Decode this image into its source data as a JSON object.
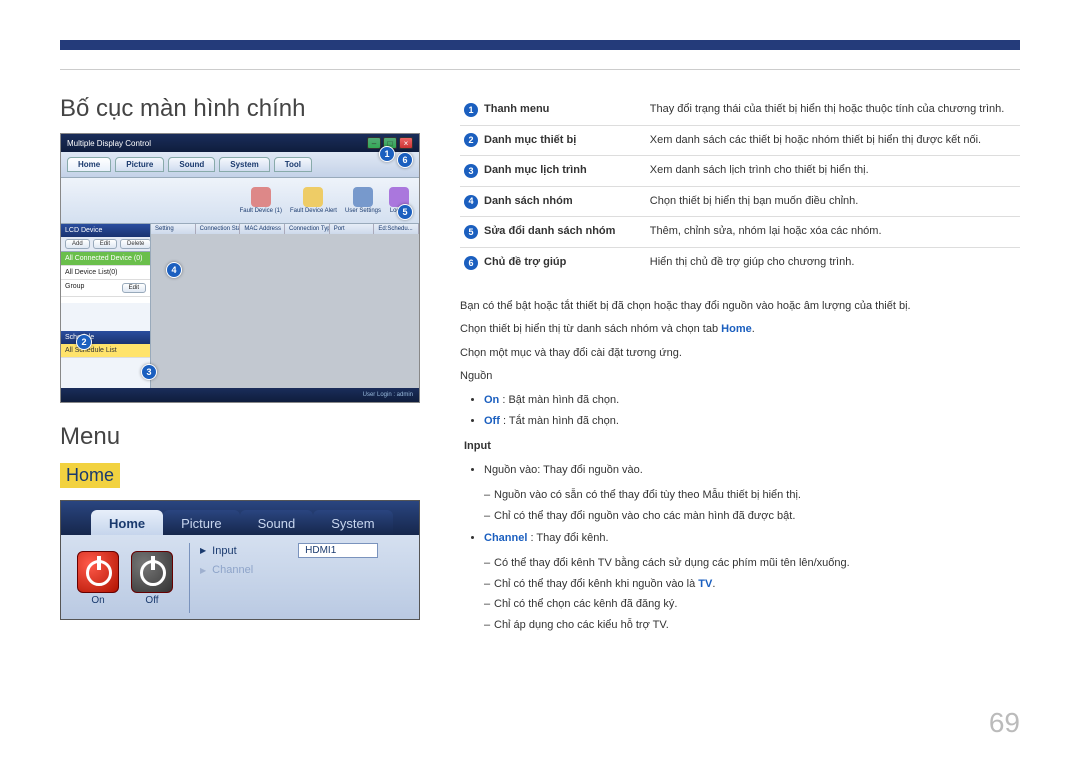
{
  "page_number": "69",
  "heading_layout": "Bố cục màn hình chính",
  "heading_menu": "Menu",
  "home_label": "Home",
  "app_window": {
    "title": "Multiple Display Control",
    "tabs": [
      "Home",
      "Picture",
      "Sound",
      "System",
      "Tool"
    ],
    "toolbar_icons": [
      "Fault Device (1)",
      "Fault Device Alert",
      "User Settings",
      "Logout"
    ],
    "side_header1": "LCD Device",
    "mini_buttons": [
      "Add",
      "Edit",
      "Delete"
    ],
    "side_item_green": "All Connected Device (0)",
    "side_item_white": "All Device List(0)",
    "side_group_label": "Group",
    "side_group_btn": "Edit",
    "side_header2": "Schedule",
    "side_item_yellow": "All Schedule List",
    "grid_headers": [
      "Setting",
      "Connection Status",
      "MAC Address",
      "Connection Type",
      "Port",
      "Ed:Schedu..."
    ],
    "status_right": "User Login : admin"
  },
  "callouts_defs": [
    {
      "n": "1",
      "term": "Thanh menu",
      "desc": "Thay đổi trạng thái của thiết bị hiển thị hoặc thuộc tính của chương trình."
    },
    {
      "n": "2",
      "term": "Danh mục thiết bị",
      "desc": "Xem danh sách các thiết bị hoặc nhóm thiết bị hiển thị được kết nối."
    },
    {
      "n": "3",
      "term": "Danh mục lịch trình",
      "desc": "Xem danh sách lịch trình cho thiết bị hiển thị."
    },
    {
      "n": "4",
      "term": "Danh sách nhóm",
      "desc": "Chọn thiết bị hiển thị bạn muốn điều chỉnh."
    },
    {
      "n": "5",
      "term": "Sửa đổi danh sách nhóm",
      "desc": "Thêm, chỉnh sửa, nhóm lại hoặc xóa các nhóm."
    },
    {
      "n": "6",
      "term": "Chủ đề trợ giúp",
      "desc": "Hiển thị chủ đề trợ giúp cho chương trình."
    }
  ],
  "crop": {
    "tabs": [
      "Home",
      "Picture",
      "Sound",
      "System"
    ],
    "on_label": "On",
    "off_label": "Off",
    "rows": [
      {
        "label": "Input",
        "value": "HDMI1",
        "enabled": true
      },
      {
        "label": "Channel",
        "value": "",
        "enabled": false
      }
    ]
  },
  "body": {
    "p1": "Bạn có thể bật hoặc tắt thiết bị đã chọn hoặc thay đổi nguồn vào hoặc âm lượng của thiết bị.",
    "p2_a": "Chọn thiết bị hiển thị từ danh sách nhóm và chọn tab ",
    "p2_b": "Home",
    "p2_c": ".",
    "p3": "Chọn một mục và thay đổi cài đặt tương ứng.",
    "nguon_label": "Nguồn",
    "on_kw": "On",
    "on_text": " : Bật màn hình đã chọn.",
    "off_kw": "Off",
    "off_text": " : Tắt màn hình đã chọn.",
    "input_kw": "Input",
    "input_b1": "Nguồn vào: Thay đổi nguồn vào.",
    "input_s1": "Nguồn vào có sẵn có thể thay đổi tùy theo Mẫu thiết bị hiển thị.",
    "input_s2": "Chỉ có thể thay đổi nguồn vào cho các màn hình đã được bật.",
    "channel_kw": "Channel",
    "channel_text": " : Thay đổi kênh.",
    "ch_s1": "Có thể thay đổi kênh TV bằng cách sử dụng các phím mũi tên lên/xuống.",
    "ch_s2_a": "Chỉ có thể thay đổi kênh khi nguồn vào là ",
    "ch_s2_b": "TV",
    "ch_s2_c": ".",
    "ch_s3": "Chỉ có thể chọn các kênh đã đăng ký.",
    "ch_s4": "Chỉ áp dụng cho các kiểu hỗ trợ TV."
  }
}
